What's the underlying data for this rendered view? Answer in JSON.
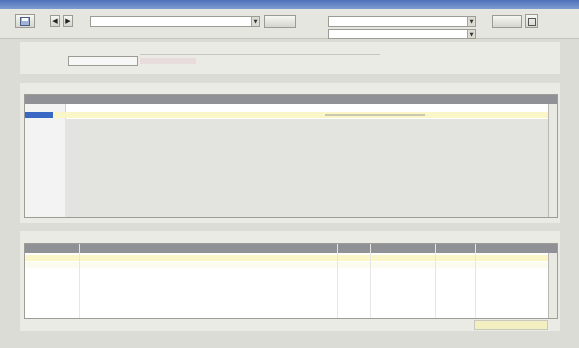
{
  "colors": {
    "accent": "#b03a20",
    "grid_header": "#8f9196",
    "selected_row": "#fbf6c8"
  },
  "icons": [
    "save-icon",
    "arrow-left-icon",
    "arrow-right-icon",
    "chevron-down-icon",
    "print-icon"
  ]
}
